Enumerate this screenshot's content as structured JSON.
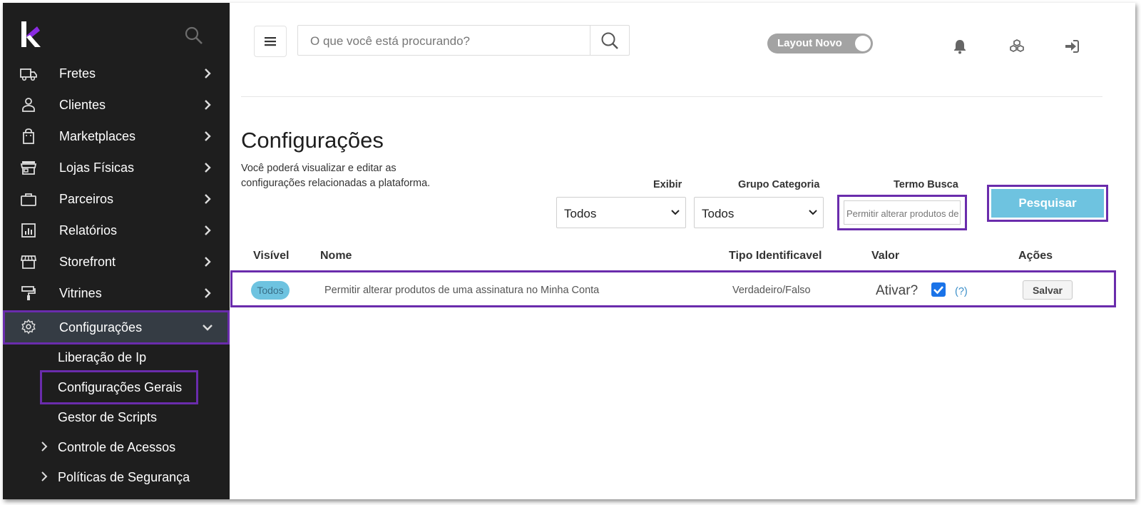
{
  "sidebar": {
    "items": [
      {
        "label": "Fretes",
        "icon": "truck-icon"
      },
      {
        "label": "Clientes",
        "icon": "user-icon"
      },
      {
        "label": "Marketplaces",
        "icon": "shopping-bag-icon"
      },
      {
        "label": "Lojas Físicas",
        "icon": "store-icon"
      },
      {
        "label": "Parceiros",
        "icon": "briefcase-icon"
      },
      {
        "label": "Relatórios",
        "icon": "report-icon"
      },
      {
        "label": "Storefront",
        "icon": "storefront-icon"
      },
      {
        "label": "Vitrines",
        "icon": "paint-roller-icon"
      },
      {
        "label": "Configurações",
        "icon": "gear-icon"
      }
    ],
    "subitems": [
      "Liberação de Ip",
      "Configurações Gerais",
      "Gestor de Scripts",
      "Controle de Acessos",
      "Políticas de Segurança"
    ]
  },
  "header": {
    "search_placeholder": "O que você está procurando?",
    "toggle_label": "Layout Novo"
  },
  "page": {
    "title": "Configurações",
    "description": "Você poderá visualizar e editar as configurações relacionadas a plataforma."
  },
  "filters": {
    "exibir_label": "Exibir",
    "exibir_value": "Todos",
    "grupo_label": "Grupo Categoria",
    "grupo_value": "Todos",
    "termo_label": "Termo Busca",
    "termo_value": "Permitir alterar produtos de uma assinatura no Minha Conta",
    "search_button": "Pesquisar"
  },
  "table": {
    "headers": [
      "Visível",
      "Nome",
      "Tipo Identificavel",
      "Valor",
      "Ações"
    ],
    "row": {
      "visivel": "Todos",
      "nome": "Permitir alterar produtos de uma assinatura no Minha Conta",
      "tipo": "Verdadeiro/Falso",
      "valor_label": "Ativar?",
      "help": "(?)",
      "action": "Salvar"
    }
  },
  "colors": {
    "sidebar_bg": "#1e1e1e",
    "active_bg": "#353c44",
    "highlight": "#6a2cac",
    "accent": "#6ec3e0",
    "logo_purple": "#8a2be2"
  }
}
